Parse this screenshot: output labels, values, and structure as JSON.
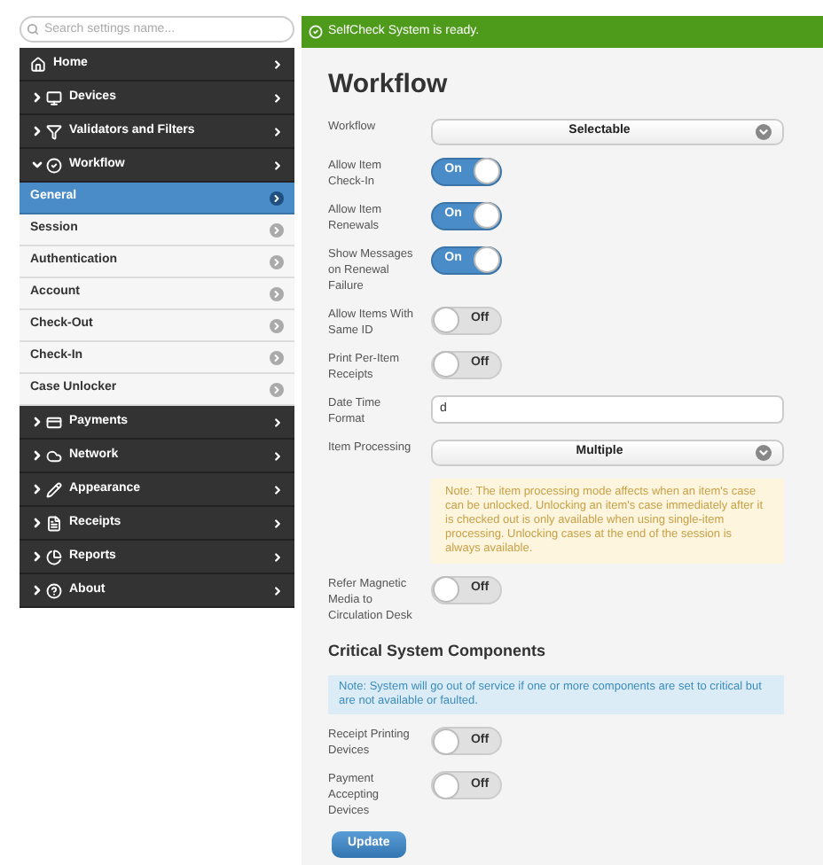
{
  "sidebar": {
    "search": {
      "placeholder": "Search settings name..."
    },
    "items": [
      {
        "kind": "link",
        "label": "Home"
      },
      {
        "kind": "section",
        "label": "Devices",
        "expanded": false
      },
      {
        "kind": "section",
        "label": "Validators and Filters",
        "expanded": false
      },
      {
        "kind": "section",
        "label": "Workflow",
        "expanded": true
      },
      {
        "kind": "page",
        "label": "General",
        "selected": true
      },
      {
        "kind": "page",
        "label": "Session",
        "selected": false
      },
      {
        "kind": "page",
        "label": "Authentication",
        "selected": false
      },
      {
        "kind": "page",
        "label": "Account",
        "selected": false
      },
      {
        "kind": "page",
        "label": "Check-Out",
        "selected": false
      },
      {
        "kind": "page",
        "label": "Check-In",
        "selected": false
      },
      {
        "kind": "page",
        "label": "Case Unlocker",
        "selected": false
      },
      {
        "kind": "section",
        "label": "Payments",
        "expanded": false
      },
      {
        "kind": "section",
        "label": "Network",
        "expanded": false
      },
      {
        "kind": "section",
        "label": "Appearance",
        "expanded": false
      },
      {
        "kind": "section",
        "label": "Receipts",
        "expanded": false
      },
      {
        "kind": "section",
        "label": "Reports",
        "expanded": false
      },
      {
        "kind": "section",
        "label": "About",
        "expanded": false
      }
    ]
  },
  "banner": {
    "text": "SelfCheck System is ready."
  },
  "page": {
    "title": "Workflow",
    "settings": [
      {
        "kind": "select",
        "label": "Workflow",
        "value": "Selectable"
      },
      {
        "kind": "toggle",
        "label": "Allow Item Check-In",
        "on": true,
        "text": "On"
      },
      {
        "kind": "toggle",
        "label": "Allow Item Renewals",
        "on": true,
        "text": "On"
      },
      {
        "kind": "toggle",
        "label": "Show Messages on Renewal Failure",
        "on": true,
        "text": "On"
      },
      {
        "kind": "toggle",
        "label": "Allow Items With Same ID",
        "on": false,
        "text": "Off"
      },
      {
        "kind": "toggle",
        "label": "Print Per-Item Receipts",
        "on": false,
        "text": "Off"
      },
      {
        "kind": "text",
        "label": "Date Time Format",
        "value": "d"
      },
      {
        "kind": "select",
        "label": "Item Processing",
        "value": "Multiple"
      },
      {
        "kind": "warning_note",
        "text": "Note: The item processing mode affects when an item's case can be unlocked. Unlocking an item's case immediately after it is checked out is only available when using single-item processing. Unlocking cases at the end of the session is always available."
      },
      {
        "kind": "toggle",
        "label": "Refer Magnetic Media to Circulation Desk",
        "on": false,
        "text": "Off"
      },
      {
        "kind": "heading",
        "text": "Critical System Components"
      },
      {
        "kind": "info_note",
        "text": "Note: System will go out of service if one or more components are set to critical but are not available or faulted."
      },
      {
        "kind": "toggle",
        "label": "Receipt Printing Devices",
        "on": false,
        "text": "Off"
      },
      {
        "kind": "toggle",
        "label": "Payment Accepting Devices",
        "on": false,
        "text": "Off"
      }
    ],
    "button": "Update"
  }
}
